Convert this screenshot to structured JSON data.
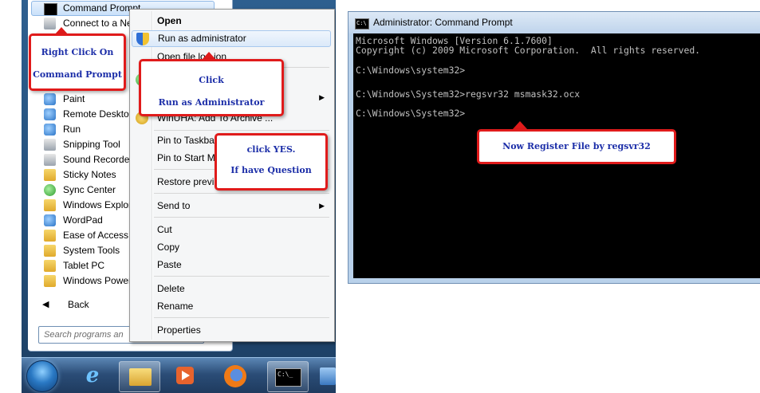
{
  "start_menu": {
    "programs": [
      {
        "label": "Command Prompt",
        "icon": "cmd-icon",
        "highlighted": true
      },
      {
        "label": "Connect to a Ne",
        "icon": "network-icon"
      },
      {
        "label": "Paint",
        "icon": "paint-icon"
      },
      {
        "label": "Remote Desktop",
        "icon": "remote-desktop-icon"
      },
      {
        "label": "Run",
        "icon": "run-icon"
      },
      {
        "label": "Snipping Tool",
        "icon": "scissors-icon"
      },
      {
        "label": "Sound Recorder",
        "icon": "microphone-icon"
      },
      {
        "label": "Sticky Notes",
        "icon": "sticky-notes-icon"
      },
      {
        "label": "Sync Center",
        "icon": "sync-icon"
      },
      {
        "label": "Windows Explor",
        "icon": "folder-icon"
      },
      {
        "label": "WordPad",
        "icon": "wordpad-icon"
      },
      {
        "label": "Ease of Access",
        "icon": "folder-icon"
      },
      {
        "label": "System Tools",
        "icon": "folder-icon"
      },
      {
        "label": "Tablet PC",
        "icon": "folder-icon"
      },
      {
        "label": "Windows Power",
        "icon": "folder-icon"
      }
    ],
    "back_label": "Back",
    "search_placeholder": "Search programs an"
  },
  "context_menu": {
    "items": {
      "open": "Open",
      "run_as_admin": "Run as administrator",
      "open_file_location": "Open file lo",
      "open_file_location_tail": "ion",
      "partial_us": "us",
      "winuha": "WinUHA: Add To Archive ...",
      "pin_taskbar": "Pin to Taskba",
      "pin_start": "Pin to Start M",
      "restore": "Restore previ",
      "send_to": "Send to",
      "cut": "Cut",
      "copy": "Copy",
      "paste": "Paste",
      "delete": "Delete",
      "rename": "Rename",
      "properties": "Properties"
    },
    "submenu_arrow": "▶"
  },
  "callouts": {
    "right_click": [
      "Right Click On",
      "Command Prompt"
    ],
    "click_run": [
      "Click",
      "Run as Administrator"
    ],
    "click_yes": [
      "click YES.",
      "If have Question"
    ],
    "register": [
      "Now Register File by regsvr32"
    ]
  },
  "taskbar": {
    "icons": [
      "windows-orb-icon",
      "internet-explorer-icon",
      "explorer-folder-icon",
      "media-player-icon",
      "firefox-icon",
      "cmd-icon"
    ]
  },
  "cmd": {
    "title": "Administrator: Command Prompt",
    "icon_text": "C:\\",
    "lines": [
      "Microsoft Windows [Version 6.1.7600]",
      "Copyright (c) 2009 Microsoft Corporation.  All rights reserved.",
      "",
      "C:\\Windows\\system32>",
      "",
      "C:\\Windows\\System32>regsvr32 msmask32.ocx",
      "",
      "C:\\Windows\\System32>"
    ]
  },
  "colors": {
    "callout_border": "#e01b1b",
    "callout_text": "#1c2ea8",
    "console_bg": "#000000",
    "console_text": "#c0c0c0"
  }
}
